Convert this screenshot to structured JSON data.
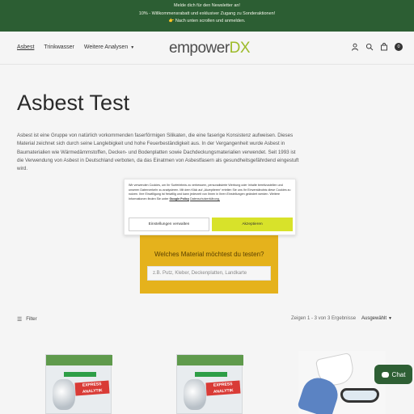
{
  "announcement": {
    "lines": [
      "Melde dich für den Newsletter an!",
      "10% - Willkommensrabatt und exklusiver Zugang zu Sonderaktionen!",
      "👉 Nach unten scrollen und anmelden."
    ]
  },
  "header": {
    "nav": [
      {
        "label": "Asbest"
      },
      {
        "label": "Trinkwasser"
      },
      {
        "label": "Weitere Analysen"
      }
    ],
    "logo": {
      "part1": "empower",
      "part2": "DX"
    },
    "cart_count": "0"
  },
  "main": {
    "title": "Asbest Test",
    "description": "Asbest ist eine Gruppe von natürlich vorkommenden faserförmigen Silikaten, die eine faserige Konsistenz aufweisen. Dieses Material zeichnet sich durch seine Langlebigkeit und hohe Feuerbeständigkeit aus. In der Vergangenheit wurde Asbest in Baumaterialien wie Wärmedämmstoffen, Decken- und Bodenplatten sowie Dachdeckungsmaterialien verwendet. Seit 1993 ist die Verwendung von Asbest in Deutschland verboten, da das Einatmen von Asbestfasern als gesundheitsgefährdend eingestuft wird."
  },
  "search_box": {
    "question": "Welches Material möchtest du testen?",
    "placeholder": "z.B. Putz, Kleber, Deckenplatten, Landkarte"
  },
  "toolbar": {
    "filter_label": "Filter",
    "results": "Zeigen 1 - 3 von 3 Ergebnisse",
    "sort_label": "Ausgewählt"
  },
  "products": [
    {
      "label": "Express Analytik",
      "badge": "EXPRESS ANALYTIK"
    },
    {
      "label": "Express Analytik",
      "badge": "EXPRESS ANALYTIK"
    },
    {
      "label": "Schutzausrüstung"
    }
  ],
  "chat": {
    "label": "Chat"
  },
  "cookie": {
    "text": "Wir verwenden Cookies, um Ihr Surferlebnis zu verbessern, personalisierte Werbung oder Inhalte bereitzustellen und unseren Datenverkehr zu analysieren. Mit dem Klick auf „Akzeptieren“ erteilen Sie uns Ihr Einverständnis diese Cookies zu nutzen. Ihre Einwilligung ist freiwillig und kann jederzeit von Ihnen in Ihren Einstellungen geändert werden. Weitere Informationen finden Sie unter",
    "google_link": "Google Policy",
    "privacy_link": "Datenschutzerklärung.",
    "settings_button": "Einstellungen verwalten",
    "accept_button": "Akzeptieren"
  },
  "colors": {
    "brand_green": "#2c5e33",
    "accent_yellow": "#e5b21c",
    "accept_lime": "#d8e22a"
  }
}
